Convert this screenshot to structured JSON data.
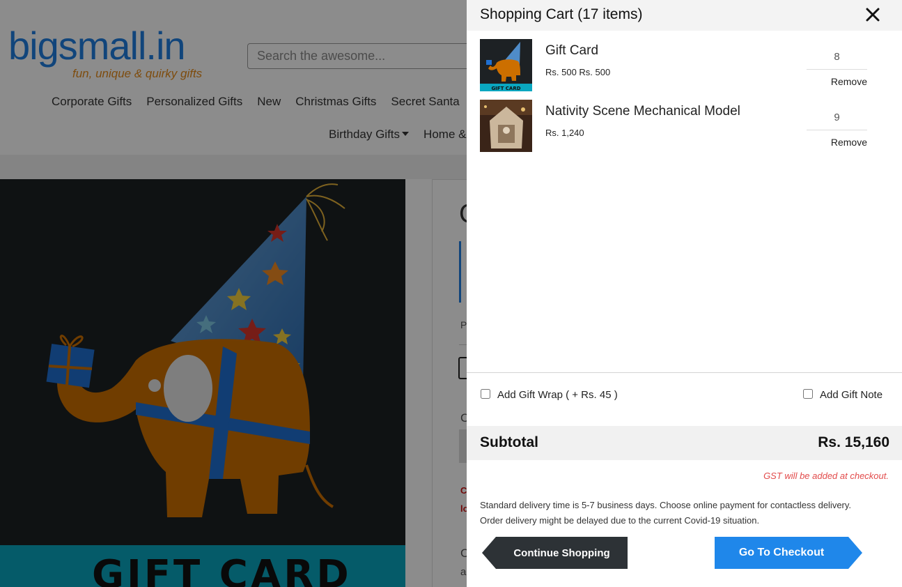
{
  "store": {
    "logo_name": "bigsmall.in",
    "logo_tagline": "fun, unique & quirky gifts",
    "search_placeholder": "Search the awesome...",
    "nav_row1": [
      "Corporate Gifts",
      "Personalized Gifts",
      "New",
      "Christmas Gifts",
      "Secret Santa"
    ],
    "nav_row2": [
      "Birthday Gifts",
      "Home &"
    ],
    "product_image_text": "GIFT CARD",
    "details_fragments": {
      "title_initial": "G",
      "p_label": "P",
      "c_label": "C",
      "red_line1": "C",
      "red_line2": "lo",
      "c_label2": "C",
      "a_label": "a"
    }
  },
  "cart": {
    "title": "Shopping Cart (17 items)",
    "items": [
      {
        "name": "Gift Card",
        "price": "Rs. 500 Rs. 500",
        "quantity": "8",
        "remove_label": "Remove",
        "thumb_text": "GIFT CARD"
      },
      {
        "name": "Nativity Scene Mechanical Model",
        "price": "Rs. 1,240",
        "quantity": "9",
        "remove_label": "Remove"
      }
    ],
    "gift_wrap_label": "Add Gift Wrap ( + Rs. 45 )",
    "gift_note_label": "Add Gift Note",
    "subtotal_label": "Subtotal",
    "subtotal_value": "Rs. 15,160",
    "gst_note": "GST will be added at checkout.",
    "delivery_line1": "Standard delivery time is 5-7 business days. Choose online payment for contactless delivery.",
    "delivery_line2": "Order delivery might be delayed due to the current Covid-19 situation.",
    "continue_label": "Continue Shopping",
    "checkout_label": "Go To Checkout"
  },
  "colors": {
    "brand_blue": "#1f7ee0",
    "brand_orange": "#e58b1a",
    "checkout_blue": "#1f87ea",
    "continue_dark": "#2d3236",
    "gst_red": "#e24b4b"
  }
}
